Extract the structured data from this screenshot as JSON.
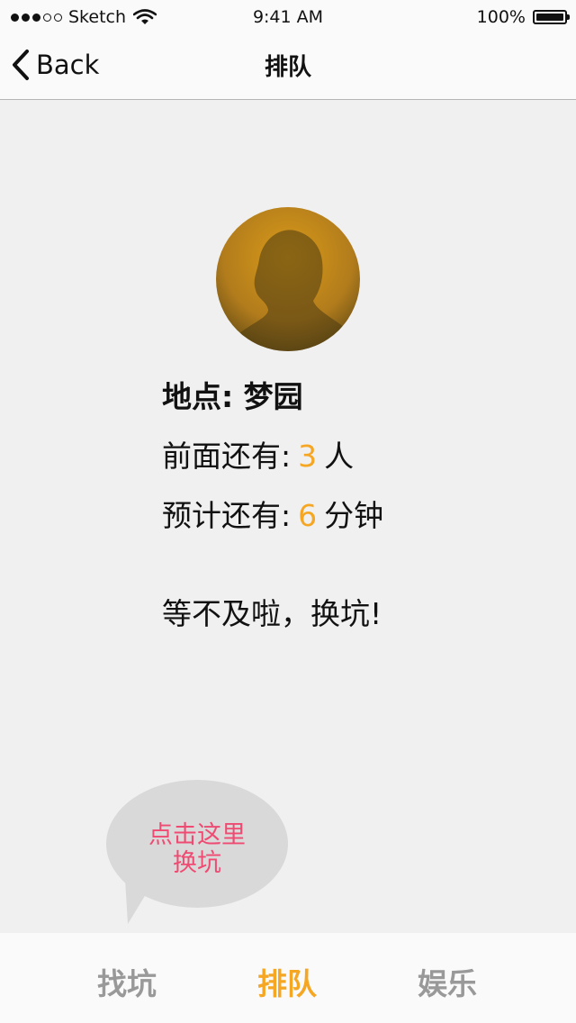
{
  "status_bar": {
    "carrier": "Sketch",
    "time": "9:41 AM",
    "battery": "100%",
    "battery_level": 1.0
  },
  "nav": {
    "back_label": "Back",
    "title": "排队"
  },
  "queue": {
    "location_label": "地点: 梦园",
    "ahead_prefix": "前面还有:",
    "ahead_count": "3",
    "ahead_unit": "人",
    "wait_prefix": "预计还有:",
    "wait_minutes": "6",
    "wait_unit": "分钟",
    "switch_label": "等不及啦，换坑!"
  },
  "bubble": {
    "line1": "点击这里",
    "line2": "换坑"
  },
  "tabs": [
    {
      "label": "找坑",
      "active": false
    },
    {
      "label": "排队",
      "active": true
    },
    {
      "label": "娱乐",
      "active": false
    }
  ],
  "colors": {
    "accent": "#f5a623",
    "bubble_text": "#ef4b72",
    "tab_inactive": "#999999"
  }
}
